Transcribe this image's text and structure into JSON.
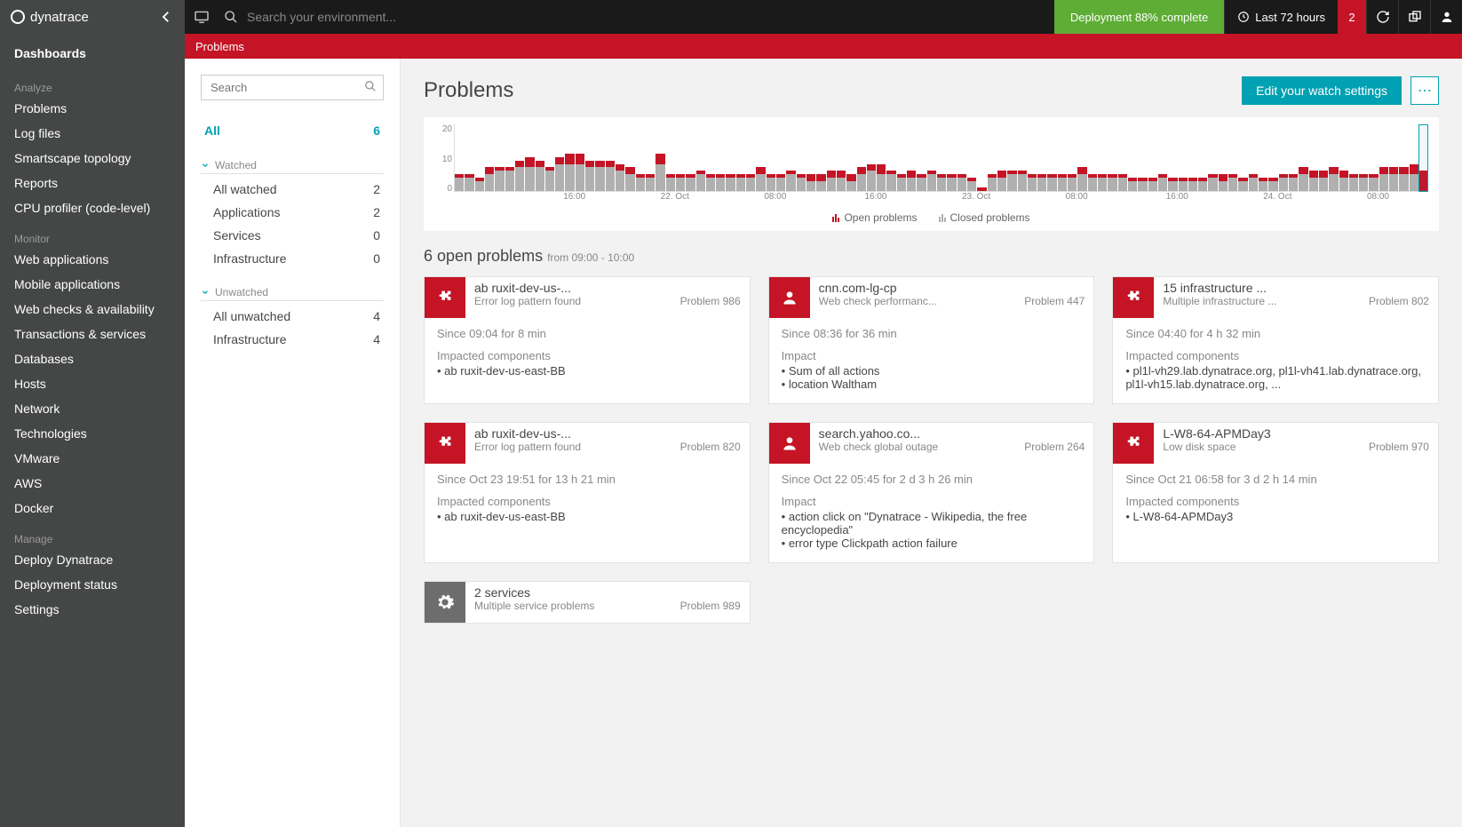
{
  "brand": "dynatrace",
  "sidebar": {
    "top": "Dashboards",
    "sections": [
      {
        "label": "Analyze",
        "items": [
          "Problems",
          "Log files",
          "Smartscape topology",
          "Reports",
          "CPU profiler (code-level)"
        ]
      },
      {
        "label": "Monitor",
        "items": [
          "Web applications",
          "Mobile applications",
          "Web checks & availability",
          "Transactions & services",
          "Databases",
          "Hosts",
          "Network",
          "Technologies",
          "VMware",
          "AWS",
          "Docker"
        ]
      },
      {
        "label": "Manage",
        "items": [
          "Deploy Dynatrace",
          "Deployment status",
          "Settings"
        ]
      }
    ]
  },
  "topbar": {
    "search_placeholder": "Search your environment...",
    "deploy": "Deployment 88% complete",
    "timeframe": "Last 72 hours",
    "alert_count": "2"
  },
  "titlebar": "Problems",
  "filters": {
    "search_placeholder": "Search",
    "all": {
      "label": "All",
      "count": "6"
    },
    "groups": [
      {
        "label": "Watched",
        "items": [
          {
            "label": "All watched",
            "count": "2"
          },
          {
            "label": "Applications",
            "count": "2"
          },
          {
            "label": "Services",
            "count": "0"
          },
          {
            "label": "Infrastructure",
            "count": "0"
          }
        ]
      },
      {
        "label": "Unwatched",
        "items": [
          {
            "label": "All unwatched",
            "count": "4"
          },
          {
            "label": "Infrastructure",
            "count": "4"
          }
        ]
      }
    ]
  },
  "workspace": {
    "title": "Problems",
    "edit_btn": "Edit your watch settings",
    "open_count": "6 open problems",
    "open_range": "from 09:00 - 10:00",
    "chart_data": {
      "type": "bar",
      "ylim": [
        0,
        20
      ],
      "yticks": [
        0,
        10,
        20
      ],
      "xticks": [
        {
          "pos": 12,
          "label": "16:00"
        },
        {
          "pos": 22,
          "label": "22. Oct"
        },
        {
          "pos": 32,
          "label": "08:00"
        },
        {
          "pos": 42,
          "label": "16:00"
        },
        {
          "pos": 52,
          "label": "23. Oct"
        },
        {
          "pos": 62,
          "label": "08:00"
        },
        {
          "pos": 72,
          "label": "16:00"
        },
        {
          "pos": 82,
          "label": "24. Oct"
        },
        {
          "pos": 92,
          "label": "08:00"
        }
      ],
      "legend": [
        "Open problems",
        "Closed problems"
      ],
      "series": [
        {
          "name": "open",
          "values": [
            1,
            1,
            1,
            2,
            1,
            1,
            2,
            3,
            2,
            1,
            2,
            3,
            3,
            2,
            2,
            2,
            2,
            2,
            1,
            1,
            3,
            1,
            1,
            1,
            1,
            1,
            1,
            1,
            1,
            1,
            2,
            1,
            1,
            1,
            1,
            2,
            2,
            2,
            2,
            2,
            2,
            2,
            3,
            1,
            1,
            2,
            1,
            1,
            1,
            1,
            1,
            1,
            1,
            1,
            2,
            1,
            1,
            1,
            1,
            1,
            1,
            1,
            2,
            1,
            1,
            1,
            1,
            1,
            1,
            1,
            1,
            1,
            1,
            1,
            1,
            1,
            2,
            1,
            1,
            1,
            1,
            1,
            1,
            1,
            2,
            2,
            2,
            2,
            2,
            1,
            1,
            1,
            2,
            2,
            2,
            3,
            6
          ]
        },
        {
          "name": "closed",
          "values": [
            4,
            4,
            3,
            5,
            6,
            6,
            7,
            7,
            7,
            6,
            8,
            8,
            8,
            7,
            7,
            7,
            6,
            5,
            4,
            4,
            8,
            4,
            4,
            4,
            5,
            4,
            4,
            4,
            4,
            4,
            5,
            4,
            4,
            5,
            4,
            3,
            3,
            4,
            4,
            3,
            5,
            6,
            5,
            5,
            4,
            4,
            4,
            5,
            4,
            4,
            4,
            3,
            0,
            4,
            4,
            5,
            5,
            4,
            4,
            4,
            4,
            4,
            5,
            4,
            4,
            4,
            4,
            3,
            3,
            3,
            4,
            3,
            3,
            3,
            3,
            4,
            3,
            4,
            3,
            4,
            3,
            3,
            4,
            4,
            5,
            4,
            4,
            5,
            4,
            4,
            4,
            4,
            5,
            5,
            5,
            5,
            0
          ]
        }
      ],
      "highlight_index": 96
    },
    "cards": [
      {
        "icon": "puzzle",
        "color": "red",
        "title": "ab ruxit-dev-us-...",
        "sub": "Error log pattern found",
        "pid": "Problem 986",
        "since": "Since 09:04 for 8 min",
        "section": "Impacted components",
        "bullets": [
          "ab ruxit-dev-us-east-BB"
        ]
      },
      {
        "icon": "user",
        "color": "red",
        "title": "cnn.com-lg-cp",
        "sub": "Web check performanc...",
        "pid": "Problem 447",
        "since": "Since 08:36 for 36 min",
        "section": "Impact",
        "bullets": [
          "Sum of all actions",
          "location Waltham"
        ]
      },
      {
        "icon": "puzzle",
        "color": "red",
        "title": "15 infrastructure ...",
        "sub": "Multiple infrastructure ...",
        "pid": "Problem 802",
        "since": "Since 04:40 for 4 h 32 min",
        "section": "Impacted components",
        "bullets": [
          "pl1l-vh29.lab.dynatrace.org, pl1l-vh41.lab.dynatrace.org, pl1l-vh15.lab.dynatrace.org, ..."
        ]
      },
      {
        "icon": "puzzle",
        "color": "red",
        "title": "ab ruxit-dev-us-...",
        "sub": "Error log pattern found",
        "pid": "Problem 820",
        "since": "Since Oct 23 19:51 for 13 h 21 min",
        "section": "Impacted components",
        "bullets": [
          "ab ruxit-dev-us-east-BB"
        ]
      },
      {
        "icon": "user",
        "color": "red",
        "title": "search.yahoo.co...",
        "sub": "Web check global outage",
        "pid": "Problem 264",
        "since": "Since Oct 22 05:45 for 2 d 3 h 26 min",
        "section": "Impact",
        "bullets": [
          "action click on \"Dynatrace - Wikipedia, the free encyclopedia\"",
          "error type Clickpath action failure"
        ]
      },
      {
        "icon": "puzzle",
        "color": "red",
        "title": "L-W8-64-APMDay3",
        "sub": "Low disk space",
        "pid": "Problem 970",
        "since": "Since Oct 21 06:58 for 3 d 2 h 14 min",
        "section": "Impacted components",
        "bullets": [
          "L-W8-64-APMDay3"
        ]
      },
      {
        "icon": "gear",
        "color": "gray",
        "title": "2 services",
        "sub": "Multiple service problems",
        "pid": "Problem 989",
        "since": "",
        "section": "",
        "bullets": []
      }
    ]
  }
}
